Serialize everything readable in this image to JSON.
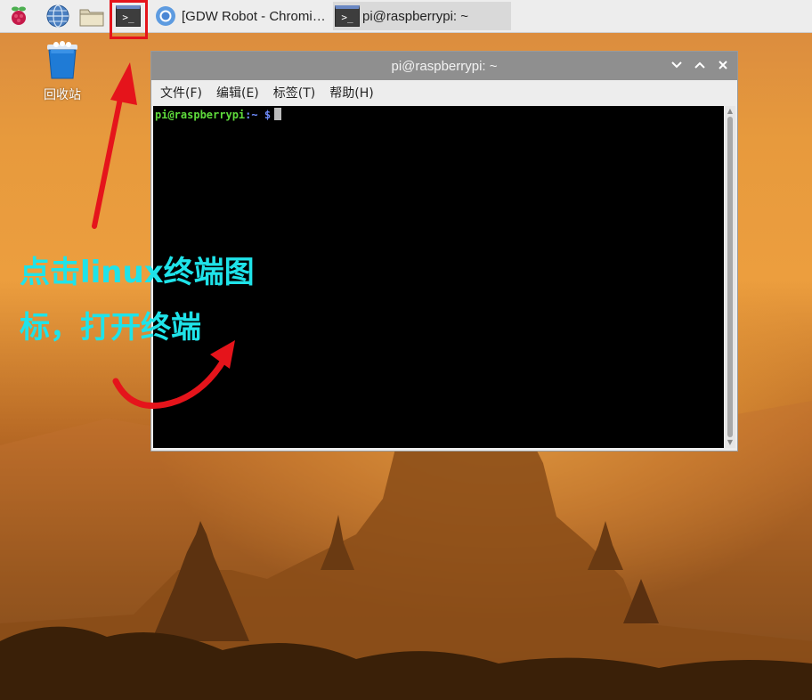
{
  "taskbar": {
    "tasks": [
      {
        "label": "[GDW Robot - Chromi…",
        "icon": "chromium-icon"
      },
      {
        "label": "pi@raspberrypi: ~",
        "icon": "terminal-icon",
        "active": true
      }
    ],
    "launchers": [
      "raspberry-menu-icon",
      "web-browser-icon",
      "file-manager-icon",
      "terminal-icon"
    ],
    "terminal_glyph": ">_"
  },
  "desktop": {
    "trash_label": "回收站"
  },
  "terminal_window": {
    "title": "pi@raspberrypi: ~",
    "menu": [
      "文件(F)",
      "编辑(E)",
      "标签(T)",
      "帮助(H)"
    ],
    "prompt_user": "pi@raspberrypi",
    "prompt_path": ":~ $"
  },
  "annotation": {
    "line1": "点击linux终端图",
    "line2": "标，打开终端",
    "color": "#1fe3e9",
    "arrow_color": "#e5141b"
  },
  "colors": {
    "titlebar": "#8f8f8f",
    "taskbar": "#ededed",
    "prompt_user": "#5fdc3c",
    "prompt_path": "#6f8dff"
  }
}
